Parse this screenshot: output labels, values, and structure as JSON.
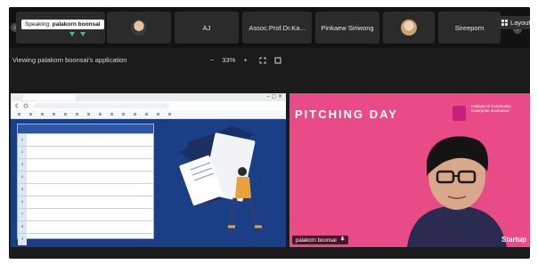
{
  "speaking": {
    "prefix": "Speaking:",
    "name": "palakorn boonsai"
  },
  "participants": [
    {
      "name": ""
    },
    {
      "name": ""
    },
    {
      "name": "AJ"
    },
    {
      "name": "Assoc.Prof.Dr.Ka..."
    },
    {
      "name": "Pinkaew Siriwong"
    },
    {
      "name": ""
    },
    {
      "name": "Sireeporn"
    }
  ],
  "controls": {
    "layout_label": "Layout"
  },
  "view": {
    "viewing_label": "Viewing palakorn boonsai's application",
    "zoom_out": "−",
    "zoom_value": "33%",
    "zoom_in": "+"
  },
  "shared_doc": {
    "tab_title": "",
    "address": "",
    "table_headers": [
      "",
      "",
      ""
    ],
    "rows": [
      {
        "num": "1",
        "text": "",
        "code": ""
      },
      {
        "num": "2",
        "text": "",
        "code": ""
      },
      {
        "num": "3",
        "text": "",
        "code": ""
      },
      {
        "num": "4",
        "text": "",
        "code": ""
      },
      {
        "num": "5",
        "text": "",
        "code": ""
      },
      {
        "num": "6",
        "text": "",
        "code": ""
      },
      {
        "num": "7",
        "text": "",
        "code": ""
      },
      {
        "num": "8",
        "text": "",
        "code": ""
      },
      {
        "num": "9",
        "text": "",
        "code": ""
      }
    ]
  },
  "speaker_video": {
    "banner_title": "PITCHING DAY",
    "logo_text": "Institute of Community Enterprise Incubation",
    "name_label": "palakorn boonsai",
    "footer_text": "Startup"
  },
  "colors": {
    "accent_pink": "#e94b86",
    "doc_blue": "#1b3f86",
    "stage_bg": "#1b1b1b"
  }
}
